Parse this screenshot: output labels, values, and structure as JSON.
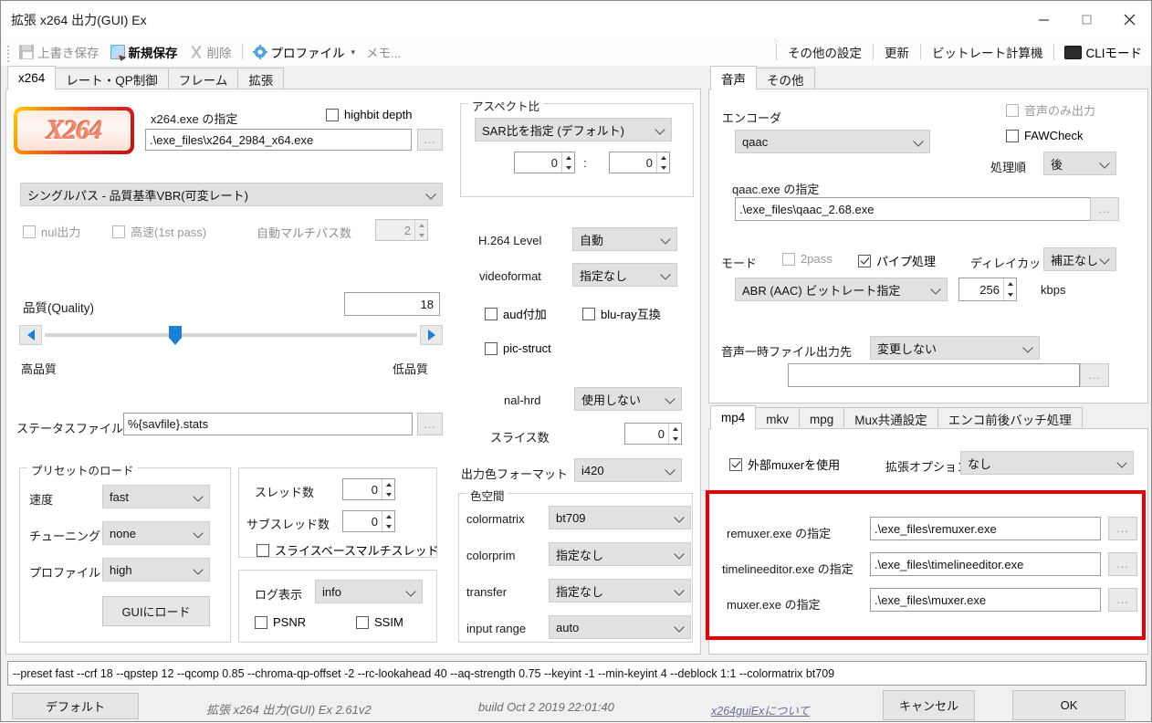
{
  "window": {
    "title": "拡張 x264 出力(GUI) Ex",
    "minimize": "—",
    "maximize": "□",
    "close": "✕"
  },
  "toolbar": {
    "overwrite_save": "上書き保存",
    "new_save": "新規保存",
    "delete": "削除",
    "profile": "プロファイル",
    "profile_caret": "▾",
    "memo": "メモ...",
    "other_settings": "その他の設定",
    "update": "更新",
    "bitrate_calc": "ビットレート計算機",
    "cli_mode": "CLIモード"
  },
  "main_tabs": [
    {
      "label": "x264",
      "active": true
    },
    {
      "label": "レート・QP制御",
      "active": false
    },
    {
      "label": "フレーム",
      "active": false
    },
    {
      "label": "拡張",
      "active": false
    }
  ],
  "left": {
    "x264_exe_label": "x264.exe の指定",
    "highbit_depth": "highbit depth",
    "x264_exe_path": ".\\exe_files\\x264_2984_x64.exe",
    "browse": "...",
    "rate_mode": "シングルパス - 品質基準VBR(可変レート)",
    "nul_output": "nul出力",
    "fast_first_pass": "高速(1st pass)",
    "auto_multipass_label": "自動マルチパス数",
    "auto_multipass_value": "2",
    "quality_label": "品質(Quality)",
    "quality_value": "18",
    "quality_high": "高品質",
    "quality_low": "低品質",
    "status_file_label": "ステータスファイル",
    "status_file_value": "%{savfile}.stats",
    "preset_group": "プリセットのロード",
    "speed_label": "速度",
    "speed_value": "fast",
    "tuning_label": "チューニング",
    "tuning_value": "none",
    "profile_label": "プロファイル",
    "profile_value": "high",
    "load_to_gui": "GUIにロード",
    "thread_label": "スレッド数",
    "thread_value": "0",
    "subthread_label": "サブスレッド数",
    "subthread_value": "0",
    "slice_based_mt": "スライスベースマルチスレッド",
    "log_label": "ログ表示",
    "log_value": "info",
    "psnr": "PSNR",
    "ssim": "SSIM",
    "aspect_group": "アスペクト比",
    "aspect_mode": "SAR比を指定 (デフォルト)",
    "aspect_w": "0",
    "aspect_colon": ":",
    "aspect_h": "0",
    "h264_level_label": "H.264 Level",
    "h264_level_value": "自動",
    "videoformat_label": "videoformat",
    "videoformat_value": "指定なし",
    "aud": "aud付加",
    "bluray": "blu-ray互換",
    "pic_struct": "pic-struct",
    "nal_hrd_label": "nal-hrd",
    "nal_hrd_value": "使用しない",
    "slices_label": "スライス数",
    "slices_value": "0",
    "out_colorfmt_label": "出力色フォーマット",
    "out_colorfmt_value": "i420",
    "colorspace_group": "色空間",
    "colormatrix_label": "colormatrix",
    "colormatrix_value": "bt709",
    "colorprim_label": "colorprim",
    "colorprim_value": "指定なし",
    "transfer_label": "transfer",
    "transfer_value": "指定なし",
    "input_range_label": "input range",
    "input_range_value": "auto"
  },
  "audio": {
    "tabs": [
      {
        "label": "音声",
        "active": true
      },
      {
        "label": "その他",
        "active": false
      }
    ],
    "encoder_label": "エンコーダ",
    "encoder_value": "qaac",
    "audio_only": "音声のみ出力",
    "faw_check": "FAWCheck",
    "order_label": "処理順",
    "order_value": "後",
    "qaac_exe_label": "qaac.exe の指定",
    "qaac_exe_path": ".\\exe_files\\qaac_2.68.exe",
    "browse": "...",
    "mode_label": "モード",
    "twopass": "2pass",
    "pipe": "パイプ処理",
    "delaycut_label": "ディレイカット",
    "delaycut_value": "補正なし",
    "bitrate_mode": "ABR (AAC) ビットレート指定",
    "bitrate_value": "256",
    "bitrate_unit": "kbps",
    "temp_out_label": "音声一時ファイル出力先",
    "temp_out_value": "変更しない",
    "temp_out_path": ""
  },
  "mux": {
    "tabs": [
      {
        "label": "mp4",
        "active": true
      },
      {
        "label": "mkv",
        "active": false
      },
      {
        "label": "mpg",
        "active": false
      },
      {
        "label": "Mux共通設定",
        "active": false
      },
      {
        "label": "エンコ前後バッチ処理",
        "active": false
      }
    ],
    "use_ext_muxer": "外部muxerを使用",
    "ext_option_label": "拡張オプション",
    "ext_option_value": "なし",
    "rows": [
      {
        "label": "remuxer.exe の指定",
        "value": ".\\exe_files\\remuxer.exe",
        "browse": "..."
      },
      {
        "label": "timelineeditor.exe の指定",
        "value": ".\\exe_files\\timelineeditor.exe",
        "browse": "..."
      },
      {
        "label": "muxer.exe の指定",
        "value": ".\\exe_files\\muxer.exe",
        "browse": "..."
      }
    ],
    "highlight_color": "#e40000"
  },
  "footer": {
    "command_line": "--preset fast --crf 18 --qpstep 12 --qcomp 0.85 --chroma-qp-offset -2 --rc-lookahead 40 --aq-strength 0.75 --keyint -1 --min-keyint 4 --deblock 1:1 --colormatrix bt709",
    "default_button": "デフォルト",
    "app_version": "拡張 x264 出力(GUI) Ex 2.61v2",
    "build": "build Oct  2 2019 22:01:40",
    "about_link": "x264guiExについて",
    "cancel_button": "キャンセル",
    "ok_button": "OK"
  }
}
